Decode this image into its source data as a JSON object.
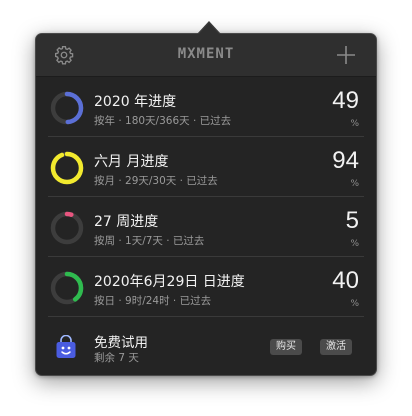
{
  "header": {
    "logo": "MXMENT"
  },
  "rows": [
    {
      "title": "2020 年进度",
      "subtitle": "按年 · 180天/366天 · 已过去",
      "value": "49",
      "unit": "%",
      "progress": 0.49,
      "color": "#5b6fd6"
    },
    {
      "title": "六月 月进度",
      "subtitle": "按月 · 29天/30天 · 已过去",
      "value": "94",
      "unit": "%",
      "progress": 0.94,
      "color": "#f2ea2e"
    },
    {
      "title": "27 周进度",
      "subtitle": "按周 · 1天/7天 · 已过去",
      "value": "5",
      "unit": "%",
      "progress": 0.05,
      "color": "#e8557f"
    },
    {
      "title": "2020年6月29日 日进度",
      "subtitle": "按日 · 9时/24时 · 已过去",
      "value": "40",
      "unit": "%",
      "progress": 0.4,
      "color": "#2fbb4f"
    }
  ],
  "trial": {
    "title": "免费试用",
    "subtitle": "剩余 7 天",
    "buy_label": "购买",
    "activate_label": "激活"
  },
  "colors": {
    "ring_track": "#3d3d3d",
    "panel": "#242424",
    "header": "#2f2f2f"
  }
}
